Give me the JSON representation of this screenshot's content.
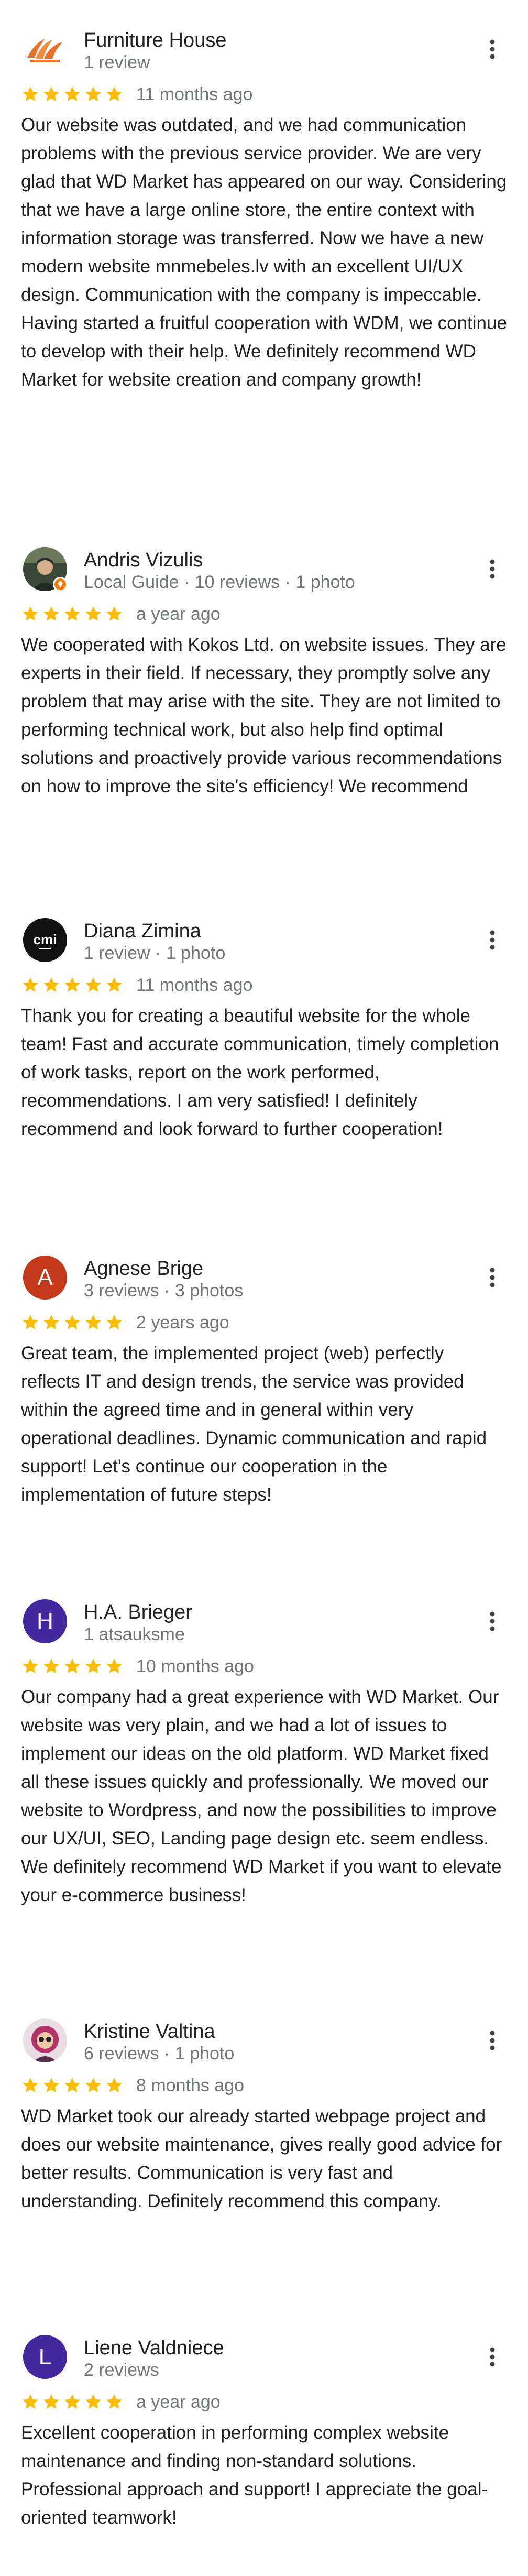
{
  "colors": {
    "star": "#fbbc04",
    "meta": "#70757a",
    "text": "#202124"
  },
  "reviews": [
    {
      "name": "Furniture House",
      "meta": "1 review",
      "stars": 5,
      "date": "11 months ago",
      "avatar": {
        "type": "logo",
        "icon": "furniture-house-logo"
      },
      "menu_icon": "more-vert-icon",
      "text": "Our website was outdated, and we had communication problems with the previous service provider. We are very glad that WD Market has appeared on our way. Considering that we have a large online store, the entire context with information storage was transferred. Now we have a new modern website mnmebeles.lv with an excellent UI/UX design. Communication with the company is impeccable. Having started a fruitful cooperation with WDM, we continue to develop with their help. We definitely recommend WD Market for website creation and company growth!"
    },
    {
      "name": "Andris Vizulis",
      "meta": "Local Guide · 10 reviews · 1 photo",
      "stars": 5,
      "date": "a year ago",
      "avatar": {
        "type": "photo",
        "icon": "profile-photo",
        "badge": "local-guide-badge-icon"
      },
      "menu_icon": "more-vert-icon",
      "text": "We cooperated with Kokos Ltd. on website issues. They are experts in their field. If necessary, they promptly solve any problem that may arise with the site. They are not limited to performing technical work, but also help find optimal solutions and proactively provide various recommendations on how to improve the site's efficiency! We recommend"
    },
    {
      "name": "Diana Zimina",
      "meta": "1 review · 1 photo",
      "stars": 5,
      "date": "11 months ago",
      "avatar": {
        "type": "logo",
        "icon": "cmi-logo",
        "text": "cmi"
      },
      "menu_icon": "more-vert-icon",
      "text": "Thank you for creating a beautiful website for the whole team! Fast and accurate communication, timely completion of work tasks, report on the work performed, recommendations. I am very satisfied! I definitely recommend and look forward to further cooperation!"
    },
    {
      "name": "Agnese Brige",
      "meta": "3 reviews · 3 photos",
      "stars": 5,
      "date": "2 years ago",
      "avatar": {
        "type": "letter",
        "letter": "A",
        "color": "#c5391b"
      },
      "menu_icon": "more-vert-icon",
      "text": "Great team, the implemented project (web) perfectly reflects IT and design trends, the service was provided within the agreed time and in general within very operational deadlines. Dynamic communication and rapid support! Let's continue our cooperation in the implementation of future steps!"
    },
    {
      "name": "H.A. Brieger",
      "meta": "1 atsauksme",
      "stars": 5,
      "date": "10 months ago",
      "avatar": {
        "type": "letter",
        "letter": "H",
        "color": "#4527a0"
      },
      "menu_icon": "more-vert-icon",
      "text": "Our company had a great experience with WD Market. Our website was very plain, and we had a lot of issues to implement our ideas on the old platform. WD Market fixed all these issues quickly and professionally. We moved our website to Wordpress, and now the possibilities to improve our UX/UI, SEO, Landing page design etc. seem endless. We definitely recommend WD Market if you want to elevate your e-commerce business!"
    },
    {
      "name": "Kristine Valtina",
      "meta": "6 reviews · 1 photo",
      "stars": 5,
      "date": "8 months ago",
      "avatar": {
        "type": "photo",
        "icon": "profile-photo"
      },
      "menu_icon": "more-vert-icon",
      "text": "WD Market took our already started webpage project and does our website maintenance, gives really good advice for better results. Communication is very fast and understanding. Definitely recommend this company."
    },
    {
      "name": "Liene Valdniece",
      "meta": "2 reviews",
      "stars": 5,
      "date": "a year ago",
      "avatar": {
        "type": "letter",
        "letter": "L",
        "color": "#4527a0"
      },
      "menu_icon": "more-vert-icon",
      "text": "Excellent cooperation in performing complex website maintenance and finding non-standard solutions. Professional approach and support! I appreciate the goal-oriented teamwork!"
    }
  ]
}
